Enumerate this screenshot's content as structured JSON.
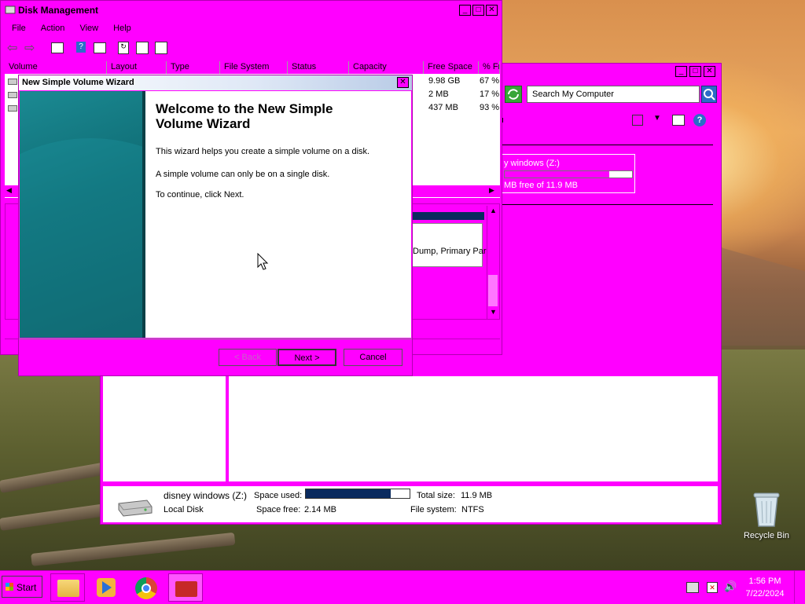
{
  "desktop": {
    "recycle_bin_label": "Recycle Bin"
  },
  "disk_management": {
    "title": "Disk Management",
    "menu": [
      "File",
      "Action",
      "View",
      "Help"
    ],
    "columns": [
      "Volume",
      "Layout",
      "Type",
      "File System",
      "Status",
      "Capacity",
      "Free Space",
      "% Fr"
    ],
    "rows": [
      {
        "free_space": "9.98 GB",
        "pct_free": "67 %"
      },
      {
        "free_space": "2 MB",
        "pct_free": "17 %"
      },
      {
        "free_space": "437 MB",
        "pct_free": "93 %"
      }
    ],
    "partition_text": "Dump, Primary Par"
  },
  "my_computer": {
    "search_placeholder": "Search My Computer",
    "drive_fragment_name": "y windows (Z:)",
    "drive_fragment_free": "MB free of 11.9 MB",
    "details": {
      "name": "disney windows (Z:)",
      "type": "Local Disk",
      "space_used_label": "Space used:",
      "space_free_label": "Space free:",
      "space_free_value": "2.14 MB",
      "total_size_label": "Total size:",
      "total_size_value": "11.9 MB",
      "file_system_label": "File system:",
      "file_system_value": "NTFS",
      "used_fraction": 0.82
    }
  },
  "wizard": {
    "title": "New Simple Volume Wizard",
    "heading": "Welcome to the New Simple Volume Wizard",
    "line1": "This wizard helps you create a simple volume on a disk.",
    "line2": "A simple volume can only be on a single disk.",
    "line3": "To continue, click Next.",
    "back_label": "< Back",
    "next_label": "Next >",
    "cancel_label": "Cancel"
  },
  "taskbar": {
    "start_label": "Start",
    "time": "1:56 PM",
    "date": "7/22/2024"
  },
  "colors": {
    "theme": "#ff00ff",
    "progress": "#0a2a5e",
    "wizard_side": "#0e6a72"
  }
}
